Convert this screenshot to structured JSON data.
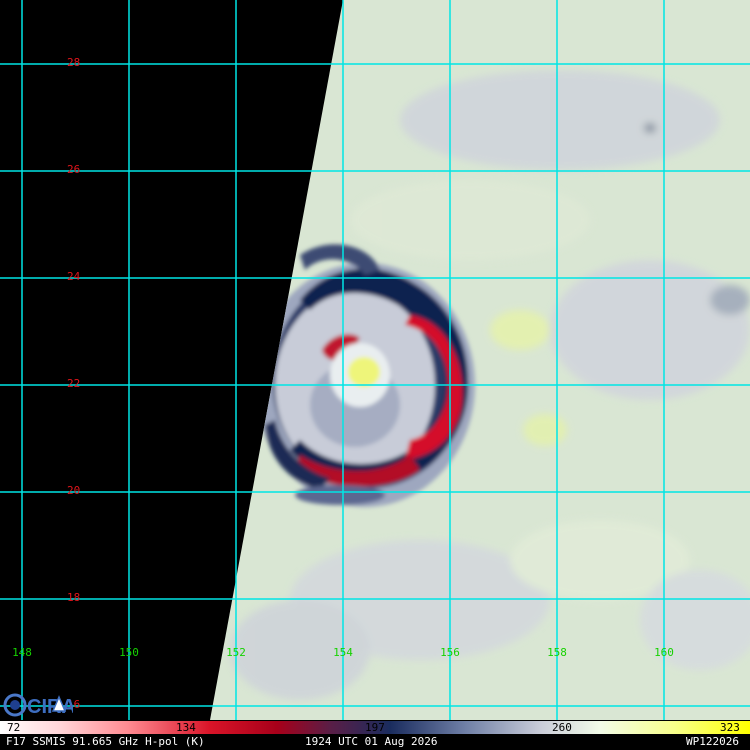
{
  "map": {
    "lat_labels": [
      "28",
      "26",
      "24",
      "22",
      "20",
      "18",
      "16"
    ],
    "lon_labels": [
      "148",
      "150",
      "152",
      "154",
      "156",
      "158",
      "160"
    ],
    "colors": {
      "grid": "#00e5e5",
      "lat_label": "#e0151b",
      "lon_label": "#16d200",
      "background_scene": "#d7e5d2",
      "no_data": "#000000",
      "cold_core": "#c8102e",
      "eye": "#eef57a"
    },
    "storm_feature": "tropical-cyclone-eye-and-eyewall"
  },
  "colorbar": {
    "ticks": [
      "72",
      "134",
      "197",
      "260",
      "323"
    ],
    "units": "(K)"
  },
  "footer": {
    "sensor": "F17 SSMIS 91.665 GHz H-pol (K)",
    "time": "1924 UTC 01 Aug 2026",
    "storm_id": "WP122026"
  },
  "logo": {
    "text": "CIRA",
    "icon": "cira-logo-icon"
  }
}
